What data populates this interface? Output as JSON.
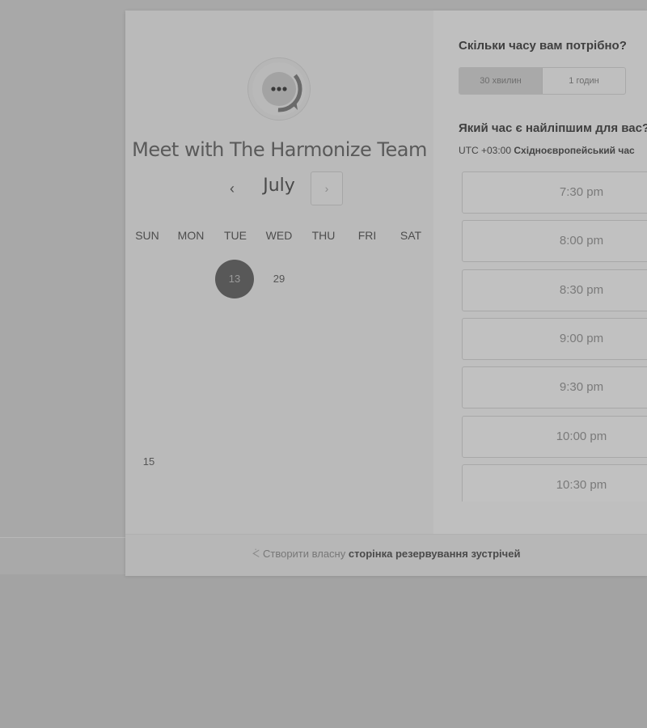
{
  "meeting": {
    "title": "Meet with The Harmonize Team",
    "avatar_icon": "chat-ellipsis-icon"
  },
  "calendar": {
    "month": "July",
    "prev_symbol": "‹",
    "next_symbol": "›",
    "weekdays": [
      "SUN",
      "MON",
      "TUE",
      "WED",
      "THU",
      "FRI",
      "SAT"
    ],
    "days": [
      {
        "label": "13",
        "selected": true
      },
      {
        "label": "29",
        "selected": false
      },
      {
        "label": "15",
        "selected": false
      }
    ]
  },
  "duration": {
    "question": "Скільки часу вам потрібно?",
    "options": [
      {
        "label": "30 хвилин",
        "active": true
      },
      {
        "label": "1 годин",
        "active": false
      }
    ]
  },
  "time": {
    "question": "Який час є найліпшим для вас?",
    "timezone_prefix": "UTC +03:00",
    "timezone_name": "Східноєвропейський час",
    "slots": [
      "7:30 pm",
      "8:00 pm",
      "8:30 pm",
      "9:00 pm",
      "9:30 pm",
      "10:00 pm",
      "10:30 pm"
    ]
  },
  "footer": {
    "icon": "hubspot-sprocket-icon",
    "prefix": "Створити власну",
    "link": "сторінка резервування зустрічей"
  },
  "colors": {
    "backdrop": "#a3a3a3",
    "left_panel": "#bababa",
    "right_panel": "#bfbfbf",
    "selected_day": "#585858"
  }
}
